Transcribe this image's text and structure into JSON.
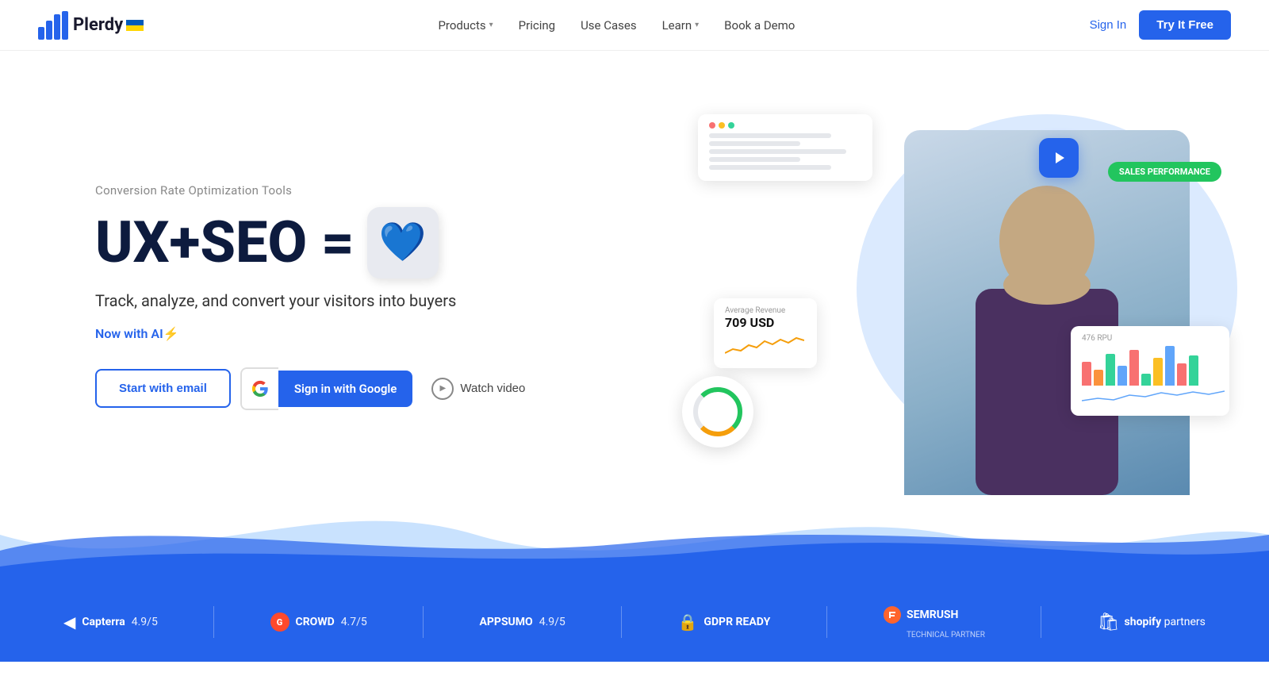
{
  "brand": {
    "name": "Plerdy",
    "logo_alt": "Plerdy logo"
  },
  "nav": {
    "items": [
      {
        "label": "Products",
        "has_dropdown": true
      },
      {
        "label": "Pricing",
        "has_dropdown": false
      },
      {
        "label": "Use Cases",
        "has_dropdown": false
      },
      {
        "label": "Learn",
        "has_dropdown": true
      },
      {
        "label": "Book a Demo",
        "has_dropdown": false
      }
    ],
    "signin_label": "Sign In",
    "try_label": "Try It Free"
  },
  "hero": {
    "subtitle": "Conversion Rate Optimization Tools",
    "heading_text": "UX+SEO =",
    "heading_emoji": "💙",
    "desc": "Track, analyze, and convert your visitors into buyers",
    "ai_label": "Now with AI⚡",
    "btn_email": "Start with email",
    "btn_google": "Sign in with Google",
    "btn_video": "Watch video"
  },
  "revenue_card": {
    "label": "Average Revenue",
    "value": "709 USD"
  },
  "sales_badge": "SALES PERFORMANCE",
  "bottom_bar": {
    "capterra": {
      "name": "Capterra",
      "score": "4.9/5"
    },
    "crowd": {
      "name": "CROWD",
      "score": "4.7/5"
    },
    "appsumo": {
      "name": "APPSUMO",
      "score": "4.9/5"
    },
    "gdpr": {
      "label": "GDPR READY"
    },
    "semrush": {
      "name": "SEMRUSH",
      "sub": "TECHNICAL PARTNER"
    },
    "shopify": {
      "label": "shopify",
      "suffix": "partners"
    }
  },
  "colors": {
    "blue": "#2563eb",
    "dark": "#0d1b3e",
    "light_blue_bg": "#dbeafe"
  }
}
